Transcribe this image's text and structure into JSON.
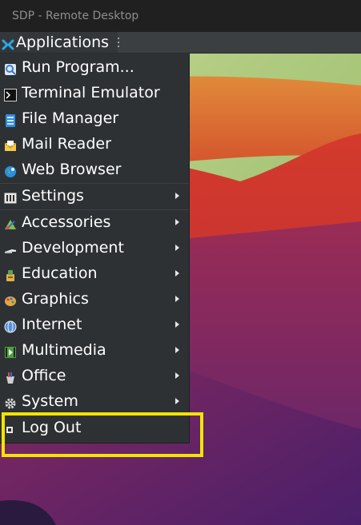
{
  "window": {
    "title": "SDP - Remote Desktop"
  },
  "panel": {
    "applications_label": "Applications",
    "handle_glyph": "⋮"
  },
  "menu": {
    "items": [
      {
        "label": "Run Program...",
        "icon": "run-program-icon",
        "submenu": false
      },
      {
        "label": "Terminal Emulator",
        "icon": "terminal-icon",
        "submenu": false
      },
      {
        "label": "File Manager",
        "icon": "file-manager-icon",
        "submenu": false
      },
      {
        "label": "Mail Reader",
        "icon": "mail-icon",
        "submenu": false
      },
      {
        "label": "Web Browser",
        "icon": "web-browser-icon",
        "submenu": false
      },
      {
        "label": "Settings",
        "icon": "settings-icon",
        "submenu": true
      },
      {
        "label": "Accessories",
        "icon": "accessories-icon",
        "submenu": true
      },
      {
        "label": "Development",
        "icon": "development-icon",
        "submenu": true
      },
      {
        "label": "Education",
        "icon": "education-icon",
        "submenu": true
      },
      {
        "label": "Graphics",
        "icon": "graphics-icon",
        "submenu": true
      },
      {
        "label": "Internet",
        "icon": "internet-icon",
        "submenu": true
      },
      {
        "label": "Multimedia",
        "icon": "multimedia-icon",
        "submenu": true
      },
      {
        "label": "Office",
        "icon": "office-icon",
        "submenu": true
      },
      {
        "label": "System",
        "icon": "gear-icon",
        "submenu": true
      },
      {
        "label": "Log Out",
        "icon": "log-out-icon",
        "submenu": false
      }
    ]
  },
  "colors": {
    "menu_background": "#2e3134",
    "highlight": "#f2e400"
  }
}
